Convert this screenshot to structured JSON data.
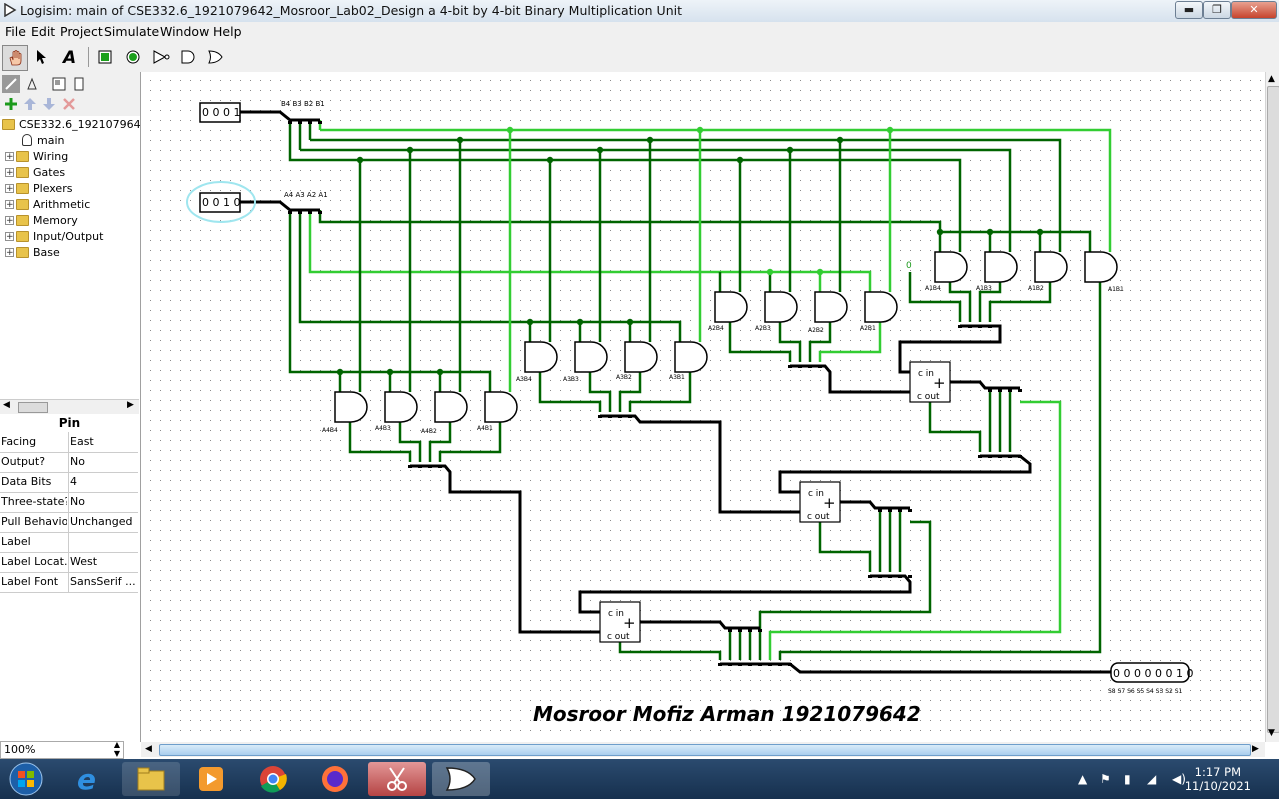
{
  "window": {
    "title": "Logisim: main of CSE332.6_1921079642_Mosroor_Lab02_Design a 4-bit by 4-bit Binary Multiplication Unit",
    "min_glyph": "▬",
    "max_glyph": "❐",
    "close_glyph": "✕"
  },
  "menu": [
    "File",
    "Edit",
    "Project",
    "Simulate",
    "Window",
    "Help"
  ],
  "toolbar": {
    "tools": [
      "hand-poke-tool-icon",
      "select-arrow-icon",
      "text-tool-icon",
      "input-pin-icon",
      "output-pin-icon",
      "not-gate-icon",
      "and-gate-icon",
      "or-gate-icon"
    ]
  },
  "tree": {
    "project": "CSE332.6_1921079642_",
    "circuit": "main",
    "libraries": [
      "Wiring",
      "Gates",
      "Plexers",
      "Arithmetic",
      "Memory",
      "Input/Output",
      "Base"
    ],
    "expand_glyph": "+"
  },
  "properties": {
    "title": "Pin",
    "rows": [
      {
        "key": "Facing",
        "value": "East"
      },
      {
        "key": "Output?",
        "value": "No"
      },
      {
        "key": "Data Bits",
        "value": "4"
      },
      {
        "key": "Three-state?",
        "value": "No"
      },
      {
        "key": "Pull Behavior",
        "value": "Unchanged"
      },
      {
        "key": "Label",
        "value": ""
      },
      {
        "key": "Label Locat...",
        "value": "West"
      },
      {
        "key": "Label Font",
        "value": "SansSerif ..."
      }
    ]
  },
  "zoom": "100%",
  "circuit": {
    "pin_b_value": "0 0 0 1",
    "pin_a_value": "0 0 1 0",
    "splitter_b_label": "B4 B3 B2 B1",
    "splitter_a_label": "A4 A3 A2 A1",
    "constant_label": "0",
    "gate_labels_row1": [
      "A1B4",
      "A1B3",
      "A1B2",
      "A1B1"
    ],
    "gate_labels_row2": [
      "A2B4",
      "A2B3",
      "A2B2",
      "A2B1"
    ],
    "gate_labels_row3": [
      "A3B4",
      "A3B3",
      "A3B2",
      "A3B1"
    ],
    "gate_labels_row4": [
      "A4B4",
      "A4B3",
      "A4B2",
      "A4B1"
    ],
    "adder_cin": "c in",
    "adder_cout": "c out",
    "adder_symbol": "+",
    "output_value": "0 0 0 0 0 0 1 0",
    "output_label": "S8 S7 S6 S5 S4 S3 S2 S1",
    "author": "Mosroor Mofiz Arman 1921079642"
  },
  "colors": {
    "wire_dark": "#006400",
    "wire_bright": "#32cd32",
    "bus": "#000000"
  },
  "taskbar": {
    "apps": [
      "start-orb-icon",
      "internet-explorer-icon",
      "file-explorer-icon",
      "media-player-icon",
      "chrome-icon",
      "firefox-icon",
      "snipping-tool-icon",
      "logisim-icon"
    ],
    "time": "1:17 PM",
    "date": "11/10/2021"
  }
}
